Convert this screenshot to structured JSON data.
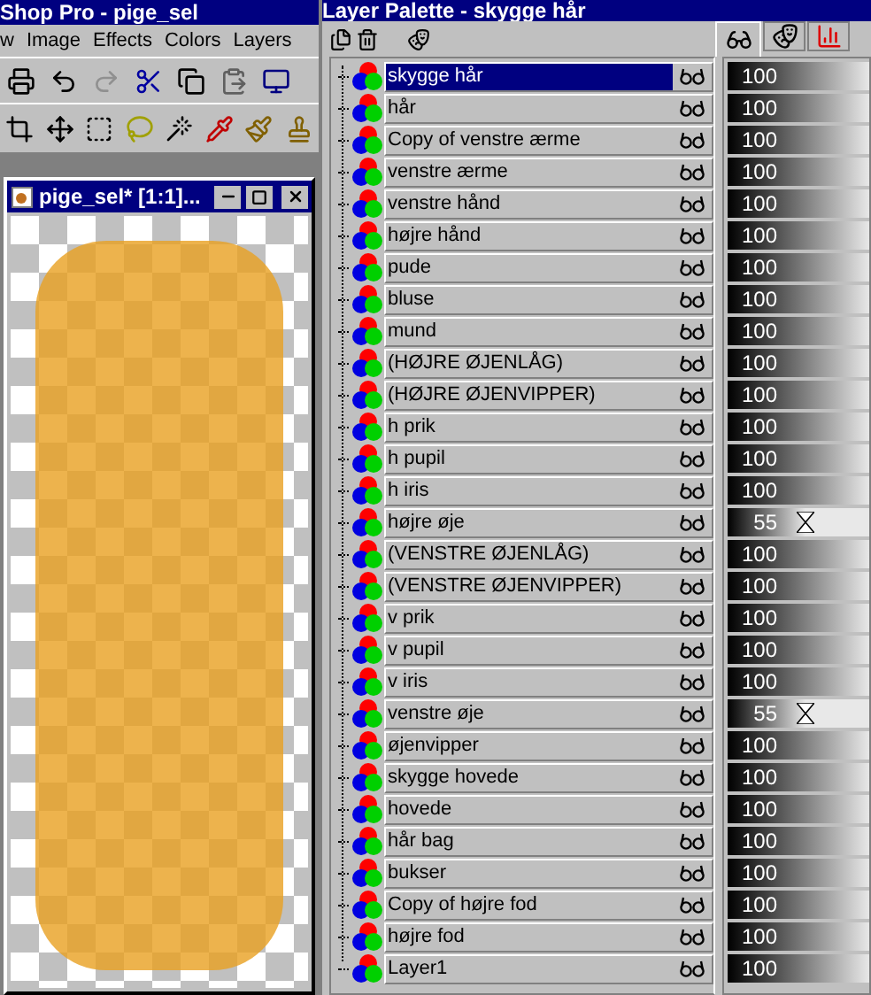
{
  "app": {
    "title": "Shop Pro - pige_sel",
    "menu": [
      "w",
      "Image",
      "Effects",
      "Colors",
      "Layers"
    ]
  },
  "document": {
    "title": "pige_sel* [1:1]..."
  },
  "layer_palette": {
    "title": "Layer Palette - skygge hår",
    "tabs": [
      {
        "kind": "visibility",
        "selected": true
      },
      {
        "kind": "mask",
        "selected": false
      },
      {
        "kind": "channels",
        "selected": false
      }
    ],
    "layers": [
      {
        "name": "skygge hår",
        "selected": true,
        "opacity": "100",
        "level": 1
      },
      {
        "name": "hår",
        "selected": false,
        "opacity": "100",
        "level": 1
      },
      {
        "name": "Copy of venstre ærme",
        "selected": false,
        "opacity": "100",
        "level": 1
      },
      {
        "name": "venstre ærme",
        "selected": false,
        "opacity": "100",
        "level": 1
      },
      {
        "name": "venstre hånd",
        "selected": false,
        "opacity": "100",
        "level": 1
      },
      {
        "name": "højre hånd",
        "selected": false,
        "opacity": "100",
        "level": 1
      },
      {
        "name": "pude",
        "selected": false,
        "opacity": "100",
        "level": 1
      },
      {
        "name": "bluse",
        "selected": false,
        "opacity": "100",
        "level": 1
      },
      {
        "name": "mund",
        "selected": false,
        "opacity": "100",
        "level": 1
      },
      {
        "name": "(HØJRE ØJENLÅG)",
        "selected": false,
        "opacity": "100",
        "level": 1
      },
      {
        "name": "(HØJRE ØJENVIPPER)",
        "selected": false,
        "opacity": "100",
        "level": 1
      },
      {
        "name": "h prik",
        "selected": false,
        "opacity": "100",
        "level": 1
      },
      {
        "name": "h pupil",
        "selected": false,
        "opacity": "100",
        "level": 1
      },
      {
        "name": "h iris",
        "selected": false,
        "opacity": "100",
        "level": 1
      },
      {
        "name": "højre øje",
        "selected": false,
        "opacity": "55",
        "level": 0.55
      },
      {
        "name": "(VENSTRE ØJENLÅG)",
        "selected": false,
        "opacity": "100",
        "level": 1
      },
      {
        "name": "(VENSTRE ØJENVIPPER)",
        "selected": false,
        "opacity": "100",
        "level": 1
      },
      {
        "name": "v prik",
        "selected": false,
        "opacity": "100",
        "level": 1
      },
      {
        "name": "v pupil",
        "selected": false,
        "opacity": "100",
        "level": 1
      },
      {
        "name": "v iris",
        "selected": false,
        "opacity": "100",
        "level": 1
      },
      {
        "name": "venstre øje",
        "selected": false,
        "opacity": "55",
        "level": 0.55
      },
      {
        "name": "øjenvipper",
        "selected": false,
        "opacity": "100",
        "level": 1
      },
      {
        "name": "skygge hovede",
        "selected": false,
        "opacity": "100",
        "level": 1
      },
      {
        "name": "hovede",
        "selected": false,
        "opacity": "100",
        "level": 1
      },
      {
        "name": "hår bag",
        "selected": false,
        "opacity": "100",
        "level": 1
      },
      {
        "name": "bukser",
        "selected": false,
        "opacity": "100",
        "level": 1
      },
      {
        "name": "Copy of højre fod",
        "selected": false,
        "opacity": "100",
        "level": 1
      },
      {
        "name": "højre fod",
        "selected": false,
        "opacity": "100",
        "level": 1
      },
      {
        "name": "Layer1",
        "selected": false,
        "opacity": "100",
        "level": 1
      }
    ]
  }
}
